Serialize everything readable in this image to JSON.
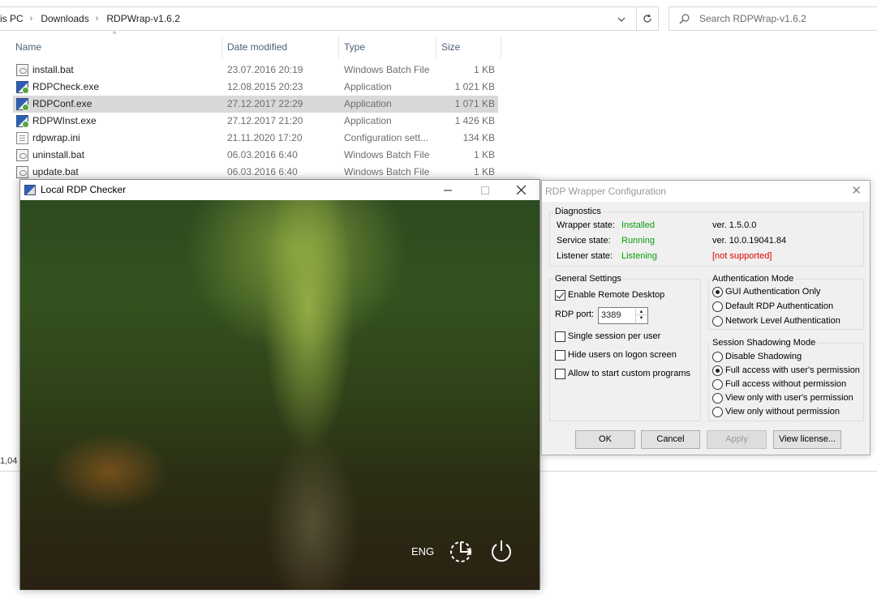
{
  "explorer": {
    "breadcrumb": [
      "is PC",
      "Downloads",
      "RDPWrap-v1.6.2"
    ],
    "search_placeholder": "Search RDPWrap-v1.6.2",
    "columns": {
      "name": "Name",
      "date": "Date modified",
      "type": "Type",
      "size": "Size"
    },
    "files": [
      {
        "name": "install.bat",
        "date": "23.07.2016 20:19",
        "type": "Windows Batch File",
        "size": "1 KB",
        "icon": "batch-file-icon"
      },
      {
        "name": "RDPCheck.exe",
        "date": "12.08.2015 20:23",
        "type": "Application",
        "size": "1 021 KB",
        "icon": "application-icon"
      },
      {
        "name": "RDPConf.exe",
        "date": "27.12.2017 22:29",
        "type": "Application",
        "size": "1 071 KB",
        "icon": "application-icon",
        "selected": true
      },
      {
        "name": "RDPWInst.exe",
        "date": "27.12.2017 21:20",
        "type": "Application",
        "size": "1 426 KB",
        "icon": "application-icon"
      },
      {
        "name": "rdpwrap.ini",
        "date": "21.11.2020 17:20",
        "type": "Configuration sett...",
        "size": "134 KB",
        "icon": "config-file-icon"
      },
      {
        "name": "uninstall.bat",
        "date": "06.03.2016 6:40",
        "type": "Windows Batch File",
        "size": "1 KB",
        "icon": "batch-file-icon"
      },
      {
        "name": "update.bat",
        "date": "06.03.2016 6:40",
        "type": "Windows Batch File",
        "size": "1 KB",
        "icon": "batch-file-icon"
      }
    ],
    "status_fragment": "1,04"
  },
  "checker": {
    "title": "Local RDP Checker",
    "language": "ENG"
  },
  "config": {
    "title": "RDP Wrapper Configuration",
    "diagnostics": {
      "label": "Diagnostics",
      "wrapper_label": "Wrapper state:",
      "wrapper_state": "Installed",
      "wrapper_ver": "ver.  1.5.0.0",
      "service_label": "Service state:",
      "service_state": "Running",
      "service_ver": "ver.  10.0.19041.84",
      "listener_label": "Listener state:",
      "listener_state": "Listening",
      "listener_note": "[not supported]"
    },
    "general": {
      "label": "General Settings",
      "enable_remote": "Enable Remote Desktop",
      "port_label": "RDP port:",
      "port_value": "3389",
      "single_session": "Single session per user",
      "hide_users": "Hide users on logon screen",
      "custom_programs": "Allow to start custom programs"
    },
    "auth": {
      "label": "Authentication Mode",
      "options": [
        "GUI Authentication Only",
        "Default RDP Authentication",
        "Network Level Authentication"
      ],
      "selected": 0
    },
    "shadow": {
      "label": "Session Shadowing Mode",
      "options": [
        "Disable Shadowing",
        "Full access with user's permission",
        "Full access without permission",
        "View only with user's permission",
        "View only without permission"
      ],
      "selected": 1
    },
    "buttons": {
      "ok": "OK",
      "cancel": "Cancel",
      "apply": "Apply",
      "license": "View license..."
    }
  }
}
